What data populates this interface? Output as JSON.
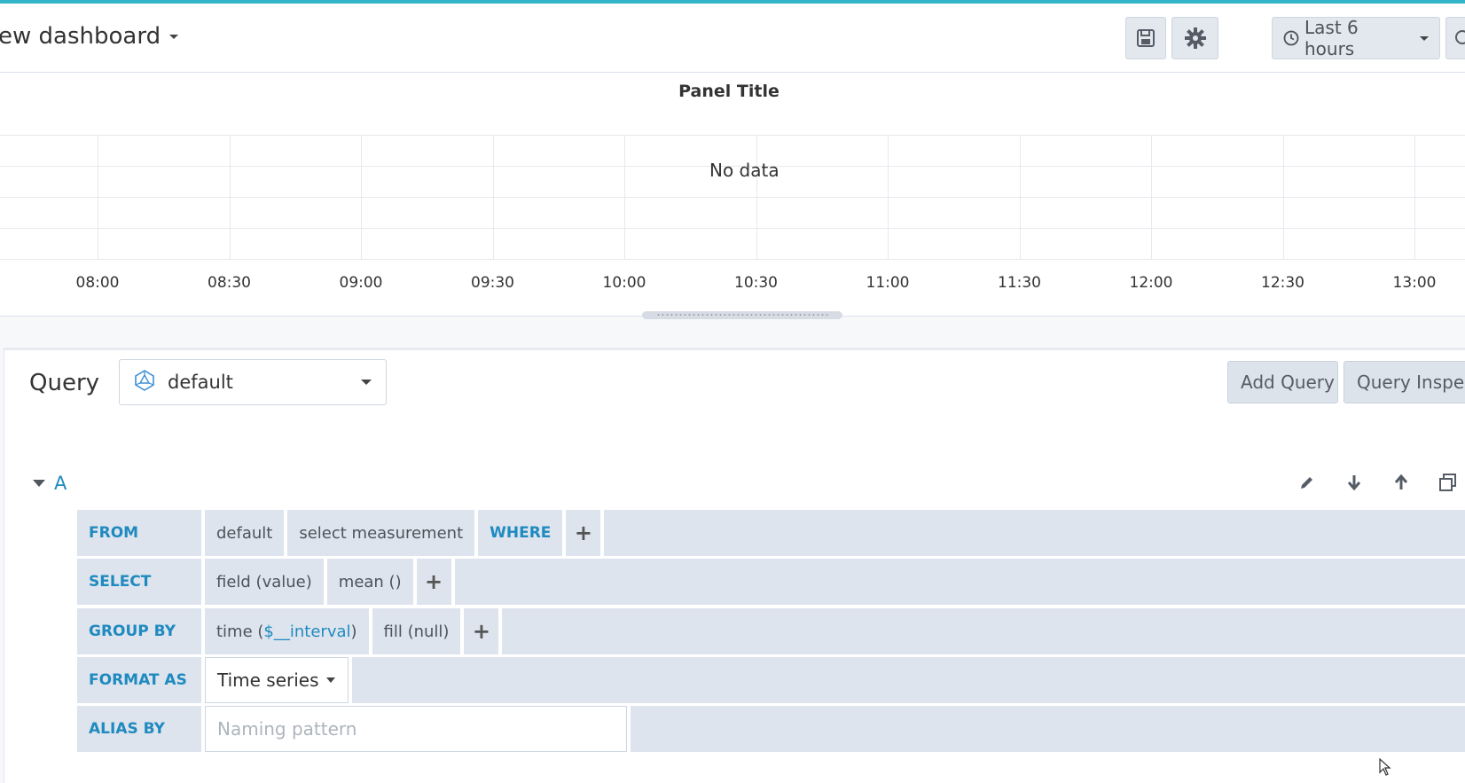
{
  "header": {
    "dashboard_title": "ew dashboard",
    "time_picker_label": "Last 6 hours"
  },
  "panel": {
    "title": "Panel Title",
    "no_data": "No data",
    "x_ticks": [
      "08:00",
      "08:30",
      "09:00",
      "09:30",
      "10:00",
      "10:30",
      "11:00",
      "11:30",
      "12:00",
      "12:30",
      "13:00"
    ]
  },
  "query_editor": {
    "label": "Query",
    "datasource": "default",
    "add_query_label": "Add Query",
    "query_inspector_label": "Query Inspect",
    "query_ref": "A",
    "rows": {
      "from": {
        "keyword": "FROM",
        "policy": "default",
        "measurement": "select measurement",
        "where": "WHERE",
        "plus": "+"
      },
      "select": {
        "keyword": "SELECT",
        "field": "field (value)",
        "func": "mean ()",
        "plus": "+"
      },
      "group_by": {
        "keyword": "GROUP BY",
        "time_prefix": "time (",
        "time_interval": "$__interval",
        "time_suffix": ")",
        "fill": "fill (null)",
        "plus": "+"
      },
      "format_as": {
        "keyword": "FORMAT AS",
        "value": "Time series"
      },
      "alias_by": {
        "keyword": "ALIAS BY",
        "placeholder": "Naming pattern"
      }
    }
  },
  "colors": {
    "accent": "#1f8ac0",
    "top_line": "#33b5c9",
    "segment_bg": "#dde4ed"
  }
}
